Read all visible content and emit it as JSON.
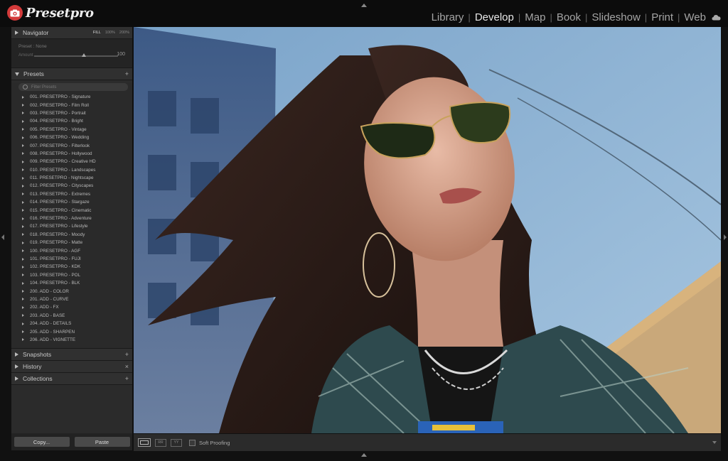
{
  "app": {
    "logo_text": "Presetpro"
  },
  "modules": [
    {
      "label": "Library"
    },
    {
      "label": "Develop"
    },
    {
      "label": "Map"
    },
    {
      "label": "Book"
    },
    {
      "label": "Slideshow"
    },
    {
      "label": "Print"
    },
    {
      "label": "Web"
    }
  ],
  "active_module": "Develop",
  "navigator": {
    "title": "Navigator",
    "zoom_options": [
      "FILL",
      "100%",
      "200%"
    ],
    "preset_label": "Preset : None",
    "amount_label": "Amount",
    "amount_value": "100"
  },
  "presets": {
    "title": "Presets",
    "add_symbol": "+",
    "filter_placeholder": "Filter Presets",
    "items": [
      "001. PRESETPRO - Signature",
      "002. PRESETPRO - Film Roll",
      "003. PRESETPRO - Portrait",
      "004. PRESETPRO - Bright",
      "005. PRESETPRO - Vintage",
      "006. PRESETPRO - Wedding",
      "007. PRESETPRO - Filterlook",
      "008. PRESETPRO - Hollywood",
      "009. PRESETPRO - Creative HD",
      "010. PRESETPRO - Landscapes",
      "011. PRESETPRO - Nightscape",
      "012. PRESETPRO - Cityscapes",
      "013. PRESETPRO - Extremes",
      "014. PRESETPRO - Stargaze",
      "015. PRESETPRO - Cinematic",
      "016. PRESETPRO - Adventure",
      "017. PRESETPRO - Lifestyle",
      "018. PRESETPRO - Moody",
      "019. PRESETPRO - Matte",
      "100. PRESETPRO - AGF",
      "101. PRESETPRO - FUJI",
      "102. PRESETPRO - KDK",
      "103. PRESETPRO - POL",
      "104. PRESETPRO - BLK",
      "200. ADD - COLOR",
      "201. ADD - CURVE",
      "202. ADD - FX",
      "203. ADD - BASE",
      "204. ADD - DETAILS",
      "205. ADD - SHARPEN",
      "206. ADD - VIGNETTE"
    ]
  },
  "panels": {
    "snapshots": {
      "title": "Snapshots",
      "action": "+"
    },
    "history": {
      "title": "History",
      "action": "×"
    },
    "collections": {
      "title": "Collections",
      "action": "+"
    }
  },
  "buttons": {
    "copy": "Copy...",
    "paste": "Paste"
  },
  "toolbar": {
    "soft_proofing": "Soft Proofing"
  },
  "colors": {
    "accent_red": "#d33a3a",
    "panel_bg": "#2b2b2b",
    "topbar_bg": "#0c0c0c"
  },
  "icons": {
    "logo": "camera-icon",
    "cloud": "cloud-icon"
  }
}
